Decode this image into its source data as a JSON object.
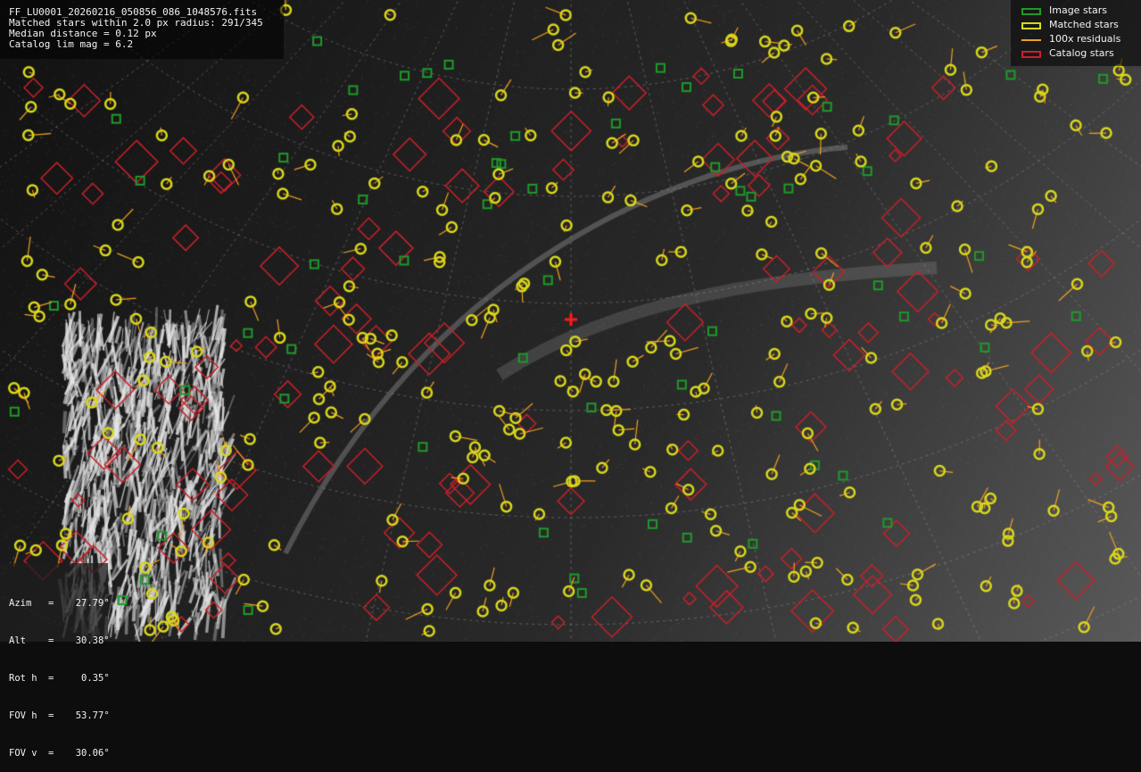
{
  "info": {
    "filename": "FF_LU0001_20260216_050856_086_1048576.fits",
    "matched_line": "Matched stars within 2.0 px radius: 291/345",
    "median_line": "Median distance = 0.12 px",
    "catalog_line": "Catalog lim mag = 6.2"
  },
  "legend": {
    "image_stars": "Image stars",
    "matched_stars": "Matched stars",
    "residuals": "100x residuals",
    "catalog_stars": "Catalog stars"
  },
  "pointing": [
    {
      "label": "Azim",
      "value": "27.79°"
    },
    {
      "label": "Alt",
      "value": "30.38°"
    },
    {
      "label": "Rot h",
      "value": "0.35°"
    },
    {
      "label": "FOV h",
      "value": "53.77°"
    },
    {
      "label": "FOV v",
      "value": "30.06°"
    }
  ],
  "colors": {
    "image_star": "#1f9a2a",
    "matched_star": "#d8d81c",
    "residual": "#f0a020",
    "catalog_star": "#c8202a",
    "center_marker": "#ff1a1a",
    "grid": "#9a9a9a"
  }
}
